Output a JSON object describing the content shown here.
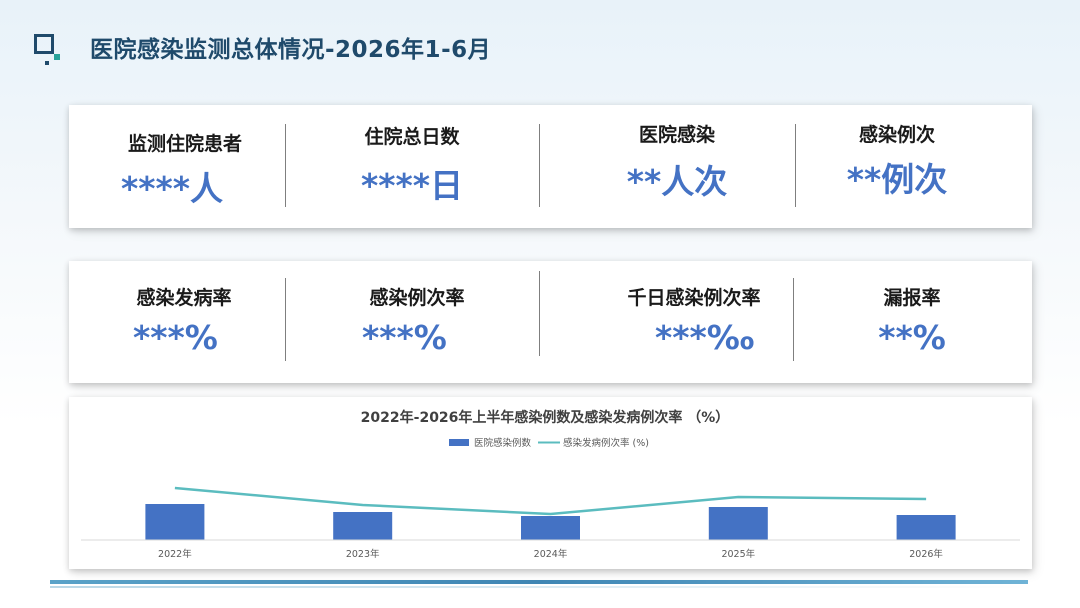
{
  "page": {
    "title": "医院感染监测总体情况-2026年1-6月"
  },
  "stats_row1": [
    {
      "label": "监测住院患者",
      "value": "****人"
    },
    {
      "label": "住院总日数",
      "value": "****日"
    },
    {
      "label": "医院感染",
      "value": "**人次"
    },
    {
      "label": "感染例次",
      "value": "**例次"
    }
  ],
  "stats_row2": [
    {
      "label": "感染发病率",
      "value": "***%"
    },
    {
      "label": "感染例次率",
      "value": "***%"
    },
    {
      "label": "千日感染例次率",
      "value": "***‰"
    },
    {
      "label": "漏报率",
      "value": "**%"
    }
  ],
  "colors": {
    "title": "#1f4a6b",
    "value": "#4472c4",
    "bar": "#4472c4",
    "line": "#5bbcbf",
    "icon_dark": "#1f4a6b",
    "icon_accent": "#2aa39a"
  },
  "chart_data": {
    "type": "bar",
    "title": "2022年-2026年上半年感染例数及感染发病例次率 （%）",
    "categories": [
      "2022年",
      "2023年",
      "2024年",
      "2025年",
      "2026年"
    ],
    "series": [
      {
        "name": "医院感染例数",
        "type": "bar",
        "values": [
          36,
          28,
          24,
          33,
          25
        ]
      },
      {
        "name": "感染发病例次率 (%)",
        "type": "line",
        "values": [
          52,
          35,
          26,
          43,
          41
        ]
      }
    ],
    "ylim": [
      0,
      100
    ],
    "legend": "top-center",
    "grid": false
  }
}
